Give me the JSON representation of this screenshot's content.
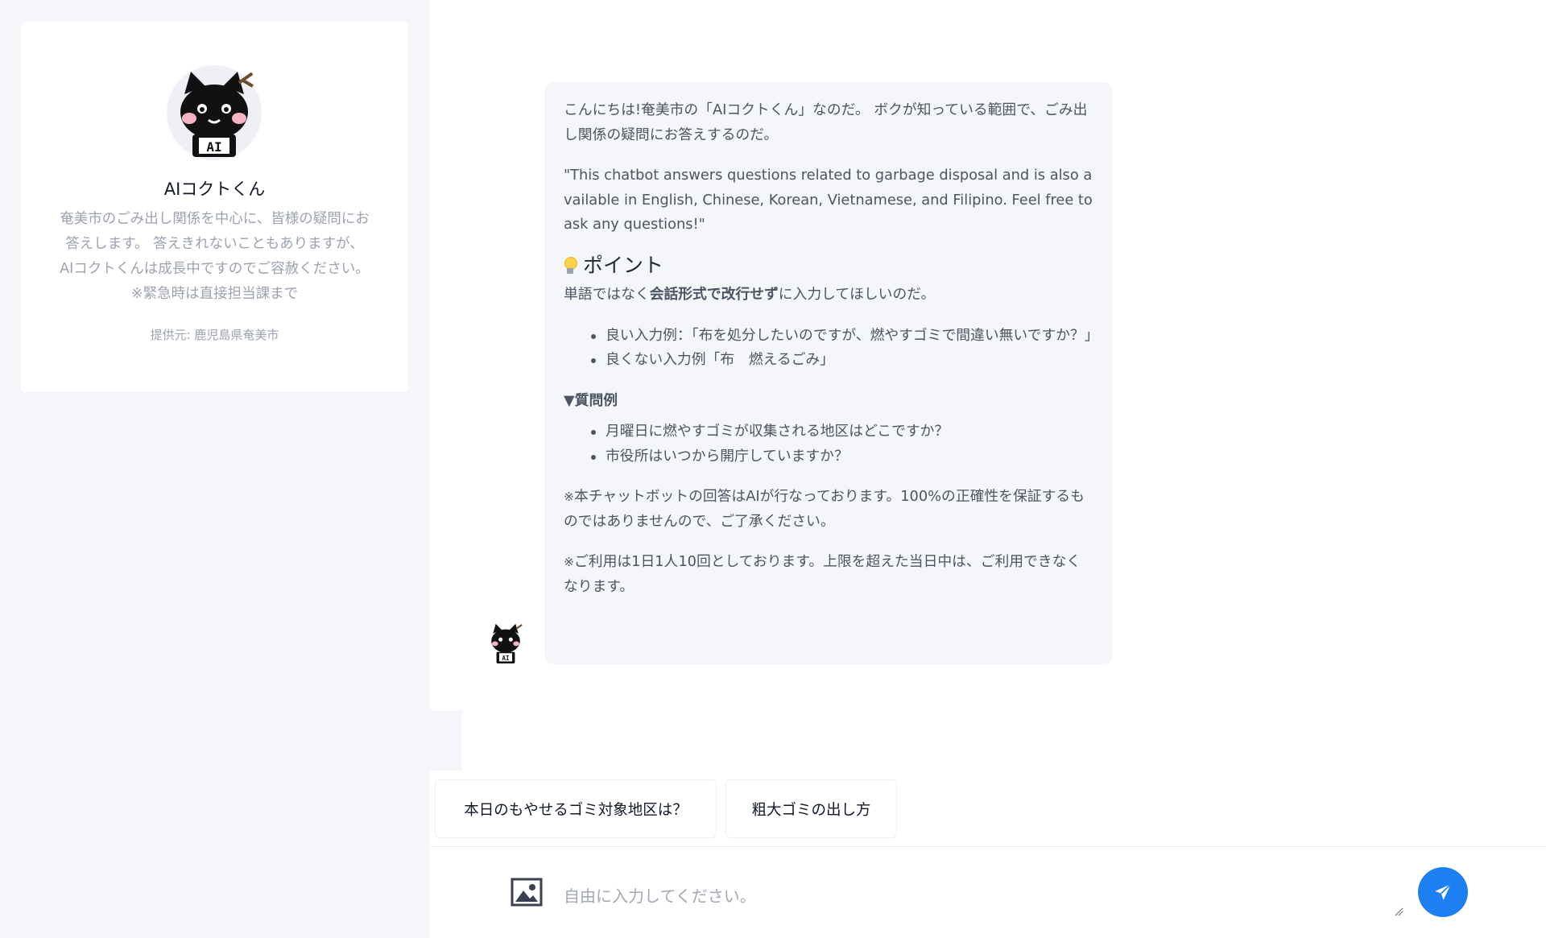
{
  "sidebar": {
    "bot_name": "AIコクトくん",
    "description": "奄美市のごみ出し関係を中心に、皆様の疑問にお\n答えします。 答えきれないこともありますが、\nAIコクトくんは成長中ですのでご容赦ください。\n※緊急時は直接担当課まで",
    "provider": "提供元: 鹿児島県奄美市",
    "avatar_icon": "black-cat-ai-mascot-icon"
  },
  "message": {
    "greeting": "こんにちは!奄美市の「AIコクトくん」なのだ。 ボクが知っている範囲で、ごみ出し関係の疑問にお答えするのだ。",
    "english_note": "\"This chatbot answers questions related to garbage disposal and is also available in English, Chinese, Korean, Vietnamese, and Filipino. Feel free to ask any questions!\"",
    "point_heading": "ポイント",
    "point_icon": "lightbulb-icon",
    "instruction_before": "単語ではなく",
    "instruction_bold": "会話形式で改行せず",
    "instruction_after": "に入力してほしいのだ。",
    "examples": [
      "良い入力例：「布を処分したいのですが、燃やすゴミで間違い無いですか？」",
      "良くない入力例「布　燃えるごみ」"
    ],
    "question_heading": "▼質問例",
    "questions": [
      "月曜日に燃やすゴミが収集される地区はどこですか？",
      "市役所はいつから開庁していますか？"
    ],
    "note1_mark": "※",
    "note1": "本チャットボットの回答はAIが行なっております。100%の正確性を保証するものではありませんので、ご了承ください。",
    "note2_mark": "※",
    "note2": "ご利用は1日1人10回としております。上限を超えた当日中は、ご利用できなくなります。"
  },
  "suggestions": [
    "本日のもやせるゴミ対象地区は？",
    "粗大ゴミの出し方"
  ],
  "input": {
    "placeholder": "自由に入力してください。",
    "value": ""
  },
  "colors": {
    "accent": "#1d7ff2",
    "sidebar_bg": "#f5f6fa",
    "bubble_bg": "#f5f6fa"
  }
}
